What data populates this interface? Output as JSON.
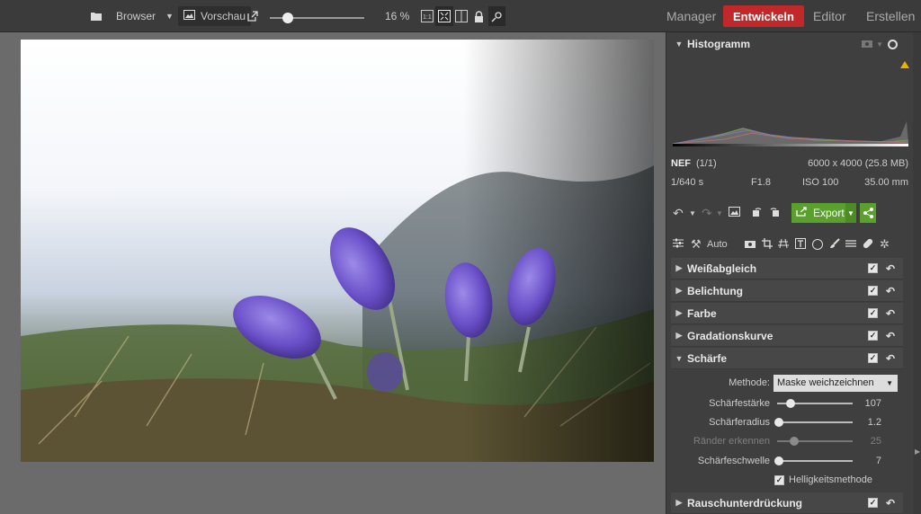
{
  "topbar": {
    "browser_label": "Browser",
    "preview_label": "Vorschau",
    "zoom_value": "16 %",
    "zoom_level": 0.16,
    "modes": {
      "manager": "Manager",
      "develop": "Entwickeln",
      "editor": "Editor",
      "create": "Erstellen"
    }
  },
  "histogram": {
    "title": "Histogramm"
  },
  "fileinfo": {
    "format": "NEF",
    "index": "(1/1)",
    "dimensions": "6000 x 4000 (25.8 MB)",
    "shutter": "1/640 s",
    "aperture": "F1.8",
    "iso": "ISO 100",
    "focal": "35.00 mm"
  },
  "toolbar": {
    "export_label": "Export",
    "auto_label": "Auto"
  },
  "sections": {
    "white_balance": "Weißabgleich",
    "exposure": "Belichtung",
    "color": "Farbe",
    "curves": "Gradationskurve",
    "sharpness": "Schärfe",
    "noise": "Rauschunterdrückung"
  },
  "sharpness": {
    "method_label": "Methode:",
    "method_value": "Maske weichzeichnen",
    "sliders": [
      {
        "label": "Schärfestärke",
        "value": "107",
        "fraction": 0.16
      },
      {
        "label": "Schärferadius",
        "value": "1.2",
        "fraction": 0.0
      },
      {
        "label": "Ränder erkennen",
        "value": "25",
        "fraction": 0.2,
        "disabled": true
      },
      {
        "label": "Schärfeschwelle",
        "value": "7",
        "fraction": 0.0
      }
    ],
    "brightness_method": "Helligkeitsmethode"
  },
  "colors": {
    "accent_red": "#c0282a",
    "accent_green": "#5aa02c"
  }
}
